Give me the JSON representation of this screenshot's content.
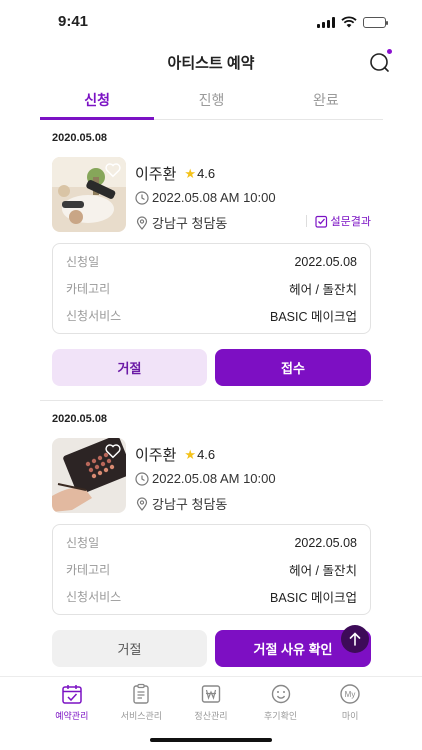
{
  "status": {
    "time": "9:41"
  },
  "header": {
    "title": "아티스트 예약"
  },
  "tabs": [
    {
      "label": "신청",
      "active": true
    },
    {
      "label": "진행",
      "active": false
    },
    {
      "label": "완료",
      "active": false
    }
  ],
  "reservations": [
    {
      "date": "2020.05.08",
      "artist_name": "이주환",
      "rating": "4.6",
      "datetime": "2022.05.08 AM 10:00",
      "location": "강남구 청담동",
      "survey_label": "설문결과",
      "details": [
        {
          "label": "신청일",
          "value": "2022.05.08"
        },
        {
          "label": "카테고리",
          "value": "헤어 / 돌잔치"
        },
        {
          "label": "신청서비스",
          "value": "BASIC 메이크업"
        }
      ],
      "reject_label": "거절",
      "accept_label": "접수"
    },
    {
      "date": "2020.05.08",
      "artist_name": "이주환",
      "rating": "4.6",
      "datetime": "2022.05.08 AM 10:00",
      "location": "강남구 청담동",
      "details": [
        {
          "label": "신청일",
          "value": "2022.05.08"
        },
        {
          "label": "카테고리",
          "value": "헤어 / 돌잔치"
        },
        {
          "label": "신청서비스",
          "value": "BASIC 메이크업"
        }
      ],
      "reject_label": "거절",
      "accept_label": "거절 사유 확인"
    }
  ],
  "nav": [
    {
      "label": "예약관리",
      "icon": "calendar-check-icon",
      "active": true
    },
    {
      "label": "서비스관리",
      "icon": "clipboard-icon",
      "active": false
    },
    {
      "label": "정산관리",
      "icon": "won-icon",
      "active": false
    },
    {
      "label": "후기확인",
      "icon": "smile-icon",
      "active": false
    },
    {
      "label": "마이",
      "icon": "my-icon",
      "active": false
    }
  ],
  "colors": {
    "accent": "#7d0fc3",
    "accent_light": "#f1e3f8",
    "star": "#f4c21a"
  }
}
